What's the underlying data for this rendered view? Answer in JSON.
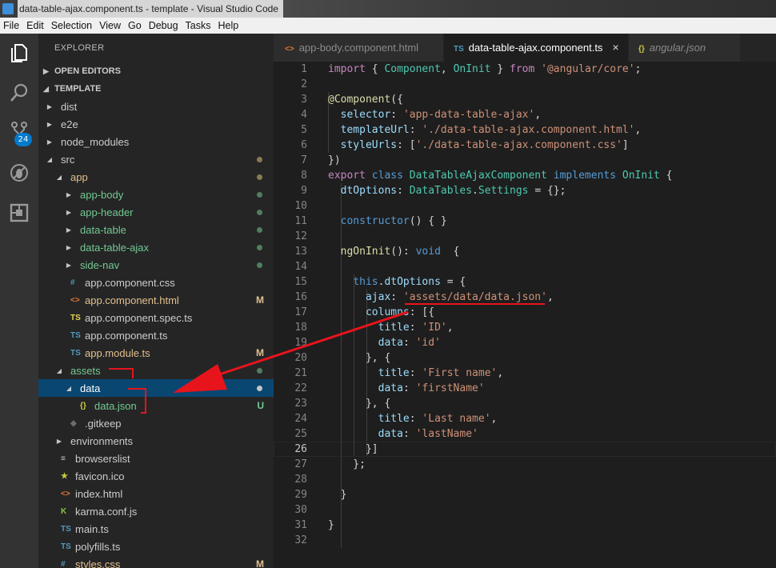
{
  "window": {
    "title": "data-table-ajax.component.ts - template - Visual Studio Code"
  },
  "menu": [
    "File",
    "Edit",
    "Selection",
    "View",
    "Go",
    "Debug",
    "Tasks",
    "Help"
  ],
  "activity": {
    "scm_badge": "24"
  },
  "explorer": {
    "title": "EXPLORER",
    "open_editors": "OPEN EDITORS",
    "project": "TEMPLATE",
    "tree": [
      {
        "label": "dist",
        "indent": 1,
        "type": "folder",
        "open": false,
        "color": "#cccccc"
      },
      {
        "label": "e2e",
        "indent": 1,
        "type": "folder",
        "open": false,
        "color": "#cccccc"
      },
      {
        "label": "node_modules",
        "indent": 1,
        "type": "folder",
        "open": false,
        "color": "#cccccc"
      },
      {
        "label": "src",
        "indent": 1,
        "type": "folder",
        "open": true,
        "color": "#cccccc",
        "dot": "#8c7b52"
      },
      {
        "label": "app",
        "indent": 2,
        "type": "folder",
        "open": true,
        "color": "#e2c08d",
        "dot": "#8c7b52"
      },
      {
        "label": "app-body",
        "indent": 3,
        "type": "folder",
        "open": false,
        "color": "#73c991",
        "dot": "#4f7f5e"
      },
      {
        "label": "app-header",
        "indent": 3,
        "type": "folder",
        "open": false,
        "color": "#73c991",
        "dot": "#4f7f5e"
      },
      {
        "label": "data-table",
        "indent": 3,
        "type": "folder",
        "open": false,
        "color": "#73c991",
        "dot": "#4f7f5e"
      },
      {
        "label": "data-table-ajax",
        "indent": 3,
        "type": "folder",
        "open": false,
        "color": "#73c991",
        "dot": "#4f7f5e"
      },
      {
        "label": "side-nav",
        "indent": 3,
        "type": "folder",
        "open": false,
        "color": "#73c991",
        "dot": "#4f7f5e"
      },
      {
        "label": "app.component.css",
        "indent": 3,
        "type": "file",
        "icon": "#",
        "icon_color": "#519aba",
        "color": "#cccccc"
      },
      {
        "label": "app.component.html",
        "indent": 3,
        "type": "file",
        "icon": "<>",
        "icon_color": "#e37933",
        "color": "#e2c08d",
        "status": "M"
      },
      {
        "label": "app.component.spec.ts",
        "indent": 3,
        "type": "file",
        "icon": "TS",
        "icon_color": "#e8d44d",
        "color": "#cccccc"
      },
      {
        "label": "app.component.ts",
        "indent": 3,
        "type": "file",
        "icon": "TS",
        "icon_color": "#519aba",
        "color": "#cccccc"
      },
      {
        "label": "app.module.ts",
        "indent": 3,
        "type": "file",
        "icon": "TS",
        "icon_color": "#519aba",
        "color": "#e2c08d",
        "status": "M"
      },
      {
        "label": "assets",
        "indent": 2,
        "type": "folder",
        "open": true,
        "color": "#73c991",
        "dot": "#4f7f5e"
      },
      {
        "label": "data",
        "indent": 3,
        "type": "folder",
        "open": true,
        "color": "#ffffff",
        "dot": "#c5c5c5",
        "selected": true
      },
      {
        "label": "data.json",
        "indent": 4,
        "type": "file",
        "icon": "{}",
        "icon_color": "#cbcb41",
        "color": "#73c991",
        "status": "U"
      },
      {
        "label": ".gitkeep",
        "indent": 3,
        "type": "file",
        "icon": "◆",
        "icon_color": "#6d6d6d",
        "color": "#cccccc"
      },
      {
        "label": "environments",
        "indent": 2,
        "type": "folder",
        "open": false,
        "color": "#cccccc"
      },
      {
        "label": "browserslist",
        "indent": 2,
        "type": "file",
        "icon": "≡",
        "icon_color": "#cccccc",
        "color": "#cccccc"
      },
      {
        "label": "favicon.ico",
        "indent": 2,
        "type": "file",
        "icon": "★",
        "icon_color": "#cbcb41",
        "color": "#cccccc"
      },
      {
        "label": "index.html",
        "indent": 2,
        "type": "file",
        "icon": "<>",
        "icon_color": "#e37933",
        "color": "#cccccc"
      },
      {
        "label": "karma.conf.js",
        "indent": 2,
        "type": "file",
        "icon": "K",
        "icon_color": "#8dc149",
        "color": "#cccccc"
      },
      {
        "label": "main.ts",
        "indent": 2,
        "type": "file",
        "icon": "TS",
        "icon_color": "#519aba",
        "color": "#cccccc"
      },
      {
        "label": "polyfills.ts",
        "indent": 2,
        "type": "file",
        "icon": "TS",
        "icon_color": "#519aba",
        "color": "#cccccc"
      },
      {
        "label": "styles.css",
        "indent": 2,
        "type": "file",
        "icon": "#",
        "icon_color": "#519aba",
        "color": "#e2c08d",
        "status": "M"
      }
    ]
  },
  "tabs": [
    {
      "icon": "<>",
      "icon_color": "#e37933",
      "label": "app-body.component.html",
      "active": false
    },
    {
      "icon": "TS",
      "icon_color": "#519aba",
      "label": "data-table-ajax.component.ts",
      "active": true,
      "close": "×"
    },
    {
      "icon": "{}",
      "icon_color": "#cbcb41",
      "label": "angular.json",
      "active": false
    }
  ],
  "editor": {
    "current_line": 26,
    "lines": [
      [
        [
          "kc",
          "import"
        ],
        [
          "pun",
          " { "
        ],
        [
          "cls",
          "Component"
        ],
        [
          "pun",
          ", "
        ],
        [
          "cls",
          "OnInit"
        ],
        [
          "pun",
          " } "
        ],
        [
          "kc",
          "from"
        ],
        [
          "pun",
          " "
        ],
        [
          "str",
          "'@angular/core'"
        ],
        [
          "pun",
          ";"
        ]
      ],
      [],
      [
        [
          "dec",
          "@Component"
        ],
        [
          "pun",
          "({"
        ]
      ],
      [
        [
          "pun",
          "  "
        ],
        [
          "prop",
          "selector"
        ],
        [
          "pun",
          ": "
        ],
        [
          "str",
          "'app-data-table-ajax'"
        ],
        [
          "pun",
          ","
        ]
      ],
      [
        [
          "pun",
          "  "
        ],
        [
          "prop",
          "templateUrl"
        ],
        [
          "pun",
          ": "
        ],
        [
          "str",
          "'./data-table-ajax.component.html'"
        ],
        [
          "pun",
          ","
        ]
      ],
      [
        [
          "pun",
          "  "
        ],
        [
          "prop",
          "styleUrls"
        ],
        [
          "pun",
          ": ["
        ],
        [
          "str",
          "'./data-table-ajax.component.css'"
        ],
        [
          "pun",
          "]"
        ]
      ],
      [
        [
          "pun",
          "})"
        ]
      ],
      [
        [
          "kc",
          "export"
        ],
        [
          "pun",
          " "
        ],
        [
          "kw",
          "class"
        ],
        [
          "pun",
          " "
        ],
        [
          "cls",
          "DataTableAjaxComponent"
        ],
        [
          "pun",
          " "
        ],
        [
          "kw",
          "implements"
        ],
        [
          "pun",
          " "
        ],
        [
          "cls",
          "OnInit"
        ],
        [
          "pun",
          " {"
        ]
      ],
      [
        [
          "pun",
          "  "
        ],
        [
          "prop",
          "dtOptions"
        ],
        [
          "pun",
          ": "
        ],
        [
          "cls",
          "DataTables"
        ],
        [
          "pun",
          "."
        ],
        [
          "cls",
          "Settings"
        ],
        [
          "pun",
          " = {};"
        ]
      ],
      [],
      [
        [
          "pun",
          "  "
        ],
        [
          "kw",
          "constructor"
        ],
        [
          "pun",
          "() { }"
        ]
      ],
      [],
      [
        [
          "pun",
          "  "
        ],
        [
          "fn",
          "ngOnInit"
        ],
        [
          "pun",
          "(): "
        ],
        [
          "kw",
          "void"
        ],
        [
          "pun",
          "  {"
        ]
      ],
      [],
      [
        [
          "pun",
          "    "
        ],
        [
          "kw",
          "this"
        ],
        [
          "pun",
          "."
        ],
        [
          "prop",
          "dtOptions"
        ],
        [
          "pun",
          " = {"
        ]
      ],
      [
        [
          "pun",
          "      "
        ],
        [
          "prop",
          "ajax"
        ],
        [
          "pun",
          ": "
        ],
        [
          "str",
          "'assets/data/data.json'"
        ],
        [
          "pun",
          ","
        ]
      ],
      [
        [
          "pun",
          "      "
        ],
        [
          "prop",
          "columns"
        ],
        [
          "pun",
          ": [{"
        ]
      ],
      [
        [
          "pun",
          "        "
        ],
        [
          "prop",
          "title"
        ],
        [
          "pun",
          ": "
        ],
        [
          "str",
          "'ID'"
        ],
        [
          "pun",
          ","
        ]
      ],
      [
        [
          "pun",
          "        "
        ],
        [
          "prop",
          "data"
        ],
        [
          "pun",
          ": "
        ],
        [
          "str",
          "'id'"
        ]
      ],
      [
        [
          "pun",
          "      }, {"
        ]
      ],
      [
        [
          "pun",
          "        "
        ],
        [
          "prop",
          "title"
        ],
        [
          "pun",
          ": "
        ],
        [
          "str",
          "'First name'"
        ],
        [
          "pun",
          ","
        ]
      ],
      [
        [
          "pun",
          "        "
        ],
        [
          "prop",
          "data"
        ],
        [
          "pun",
          ": "
        ],
        [
          "str",
          "'firstName'"
        ]
      ],
      [
        [
          "pun",
          "      }, {"
        ]
      ],
      [
        [
          "pun",
          "        "
        ],
        [
          "prop",
          "title"
        ],
        [
          "pun",
          ": "
        ],
        [
          "str",
          "'Last name'"
        ],
        [
          "pun",
          ","
        ]
      ],
      [
        [
          "pun",
          "        "
        ],
        [
          "prop",
          "data"
        ],
        [
          "pun",
          ": "
        ],
        [
          "str",
          "'lastName'"
        ]
      ],
      [
        [
          "pun",
          "      }]"
        ]
      ],
      [
        [
          "pun",
          "    };"
        ]
      ],
      [],
      [
        [
          "pun",
          "  }"
        ]
      ],
      [],
      [
        [
          "pun",
          "}"
        ]
      ],
      []
    ]
  }
}
